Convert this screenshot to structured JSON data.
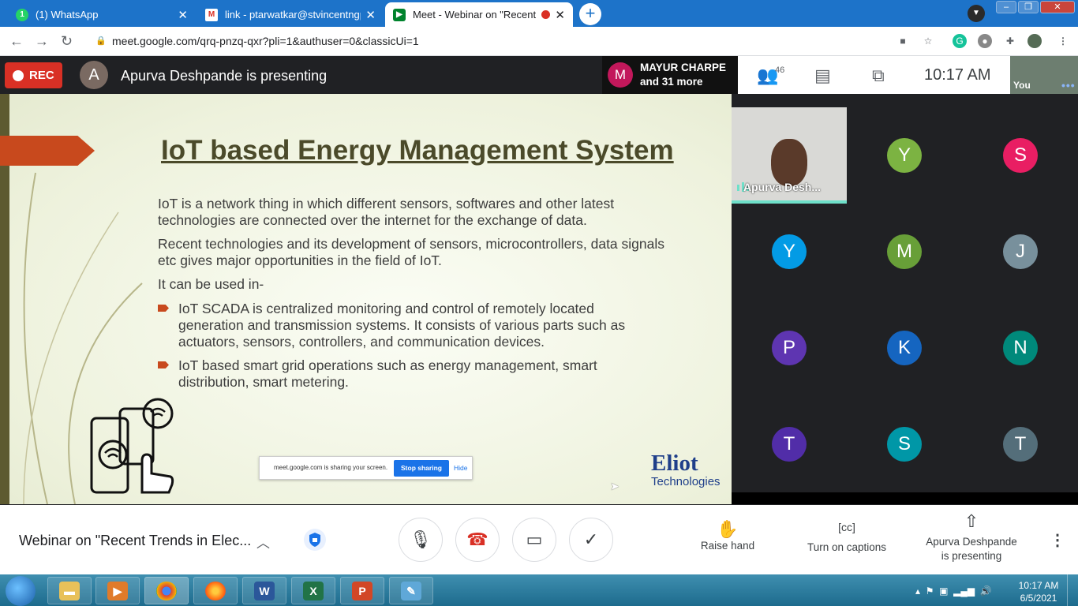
{
  "browser": {
    "tabs": [
      {
        "title": "(1) WhatsApp",
        "close": "✕"
      },
      {
        "title": "link - ptarwatkar@stvincentngp.e",
        "close": "✕"
      },
      {
        "title": "Meet - Webinar on \"Recent T",
        "close": "✕"
      }
    ],
    "new_tab": "+",
    "url": "meet.google.com/qrq-pnzq-qxr?pli=1&authuser=0&classicUi=1"
  },
  "meet": {
    "rec_label": "REC",
    "presenter_initial": "A",
    "presenting_text": "Apurva Deshpande is presenting",
    "mayur": {
      "initial": "M",
      "line1": "MAYUR CHARPE",
      "line2": "and 31 more"
    },
    "people_count": "46",
    "clock": "10:17  AM",
    "self_label": "You",
    "self_more": "•••"
  },
  "slide": {
    "title": "IoT based Energy Management System",
    "para1": "IoT is a network thing in which different sensors, softwares and other latest technologies are connected over the internet for the exchange of data.",
    "para2": "Recent technologies and its development of sensors, microcontrollers, data signals etc gives major opportunities in the field of IoT.",
    "para3": "It can be used in-",
    "bullet1": "IoT SCADA is centralized monitoring and control of remotely located generation and transmission systems. It consists of various parts such as actuators, sensors, controllers, and communication devices.",
    "bullet2": "IoT based smart grid operations such as energy management, smart distribution, smart metering.",
    "share_text": "meet.google.com is sharing your screen.",
    "stop_sharing": "Stop sharing",
    "hide": "Hide",
    "logo_line1": "Eliot",
    "logo_line2": "Technologies"
  },
  "grid": {
    "speaker_label": "Apurva Desh...",
    "participants": [
      {
        "initial": "Y",
        "color": "#7cb342"
      },
      {
        "initial": "S",
        "color": "#e91e63"
      },
      {
        "initial": "Y",
        "color": "#039be5"
      },
      {
        "initial": "M",
        "color": "#689f38"
      },
      {
        "initial": "J",
        "color": "#78909c"
      },
      {
        "initial": "P",
        "color": "#5e35b1"
      },
      {
        "initial": "K",
        "color": "#1565c0"
      },
      {
        "initial": "N",
        "color": "#00897b"
      },
      {
        "initial": "T",
        "color": "#512da8"
      },
      {
        "initial": "S",
        "color": "#0097a7"
      },
      {
        "initial": "T",
        "color": "#546e7a"
      }
    ]
  },
  "controls": {
    "meeting_title": "Webinar on \"Recent Trends in Elec...",
    "raise_hand": "Raise hand",
    "captions": "Turn on captions",
    "presenting_line1": "Apurva Deshpande",
    "presenting_line2": "is presenting"
  },
  "taskbar": {
    "time": "10:17 AM",
    "date": "6/5/2021"
  }
}
